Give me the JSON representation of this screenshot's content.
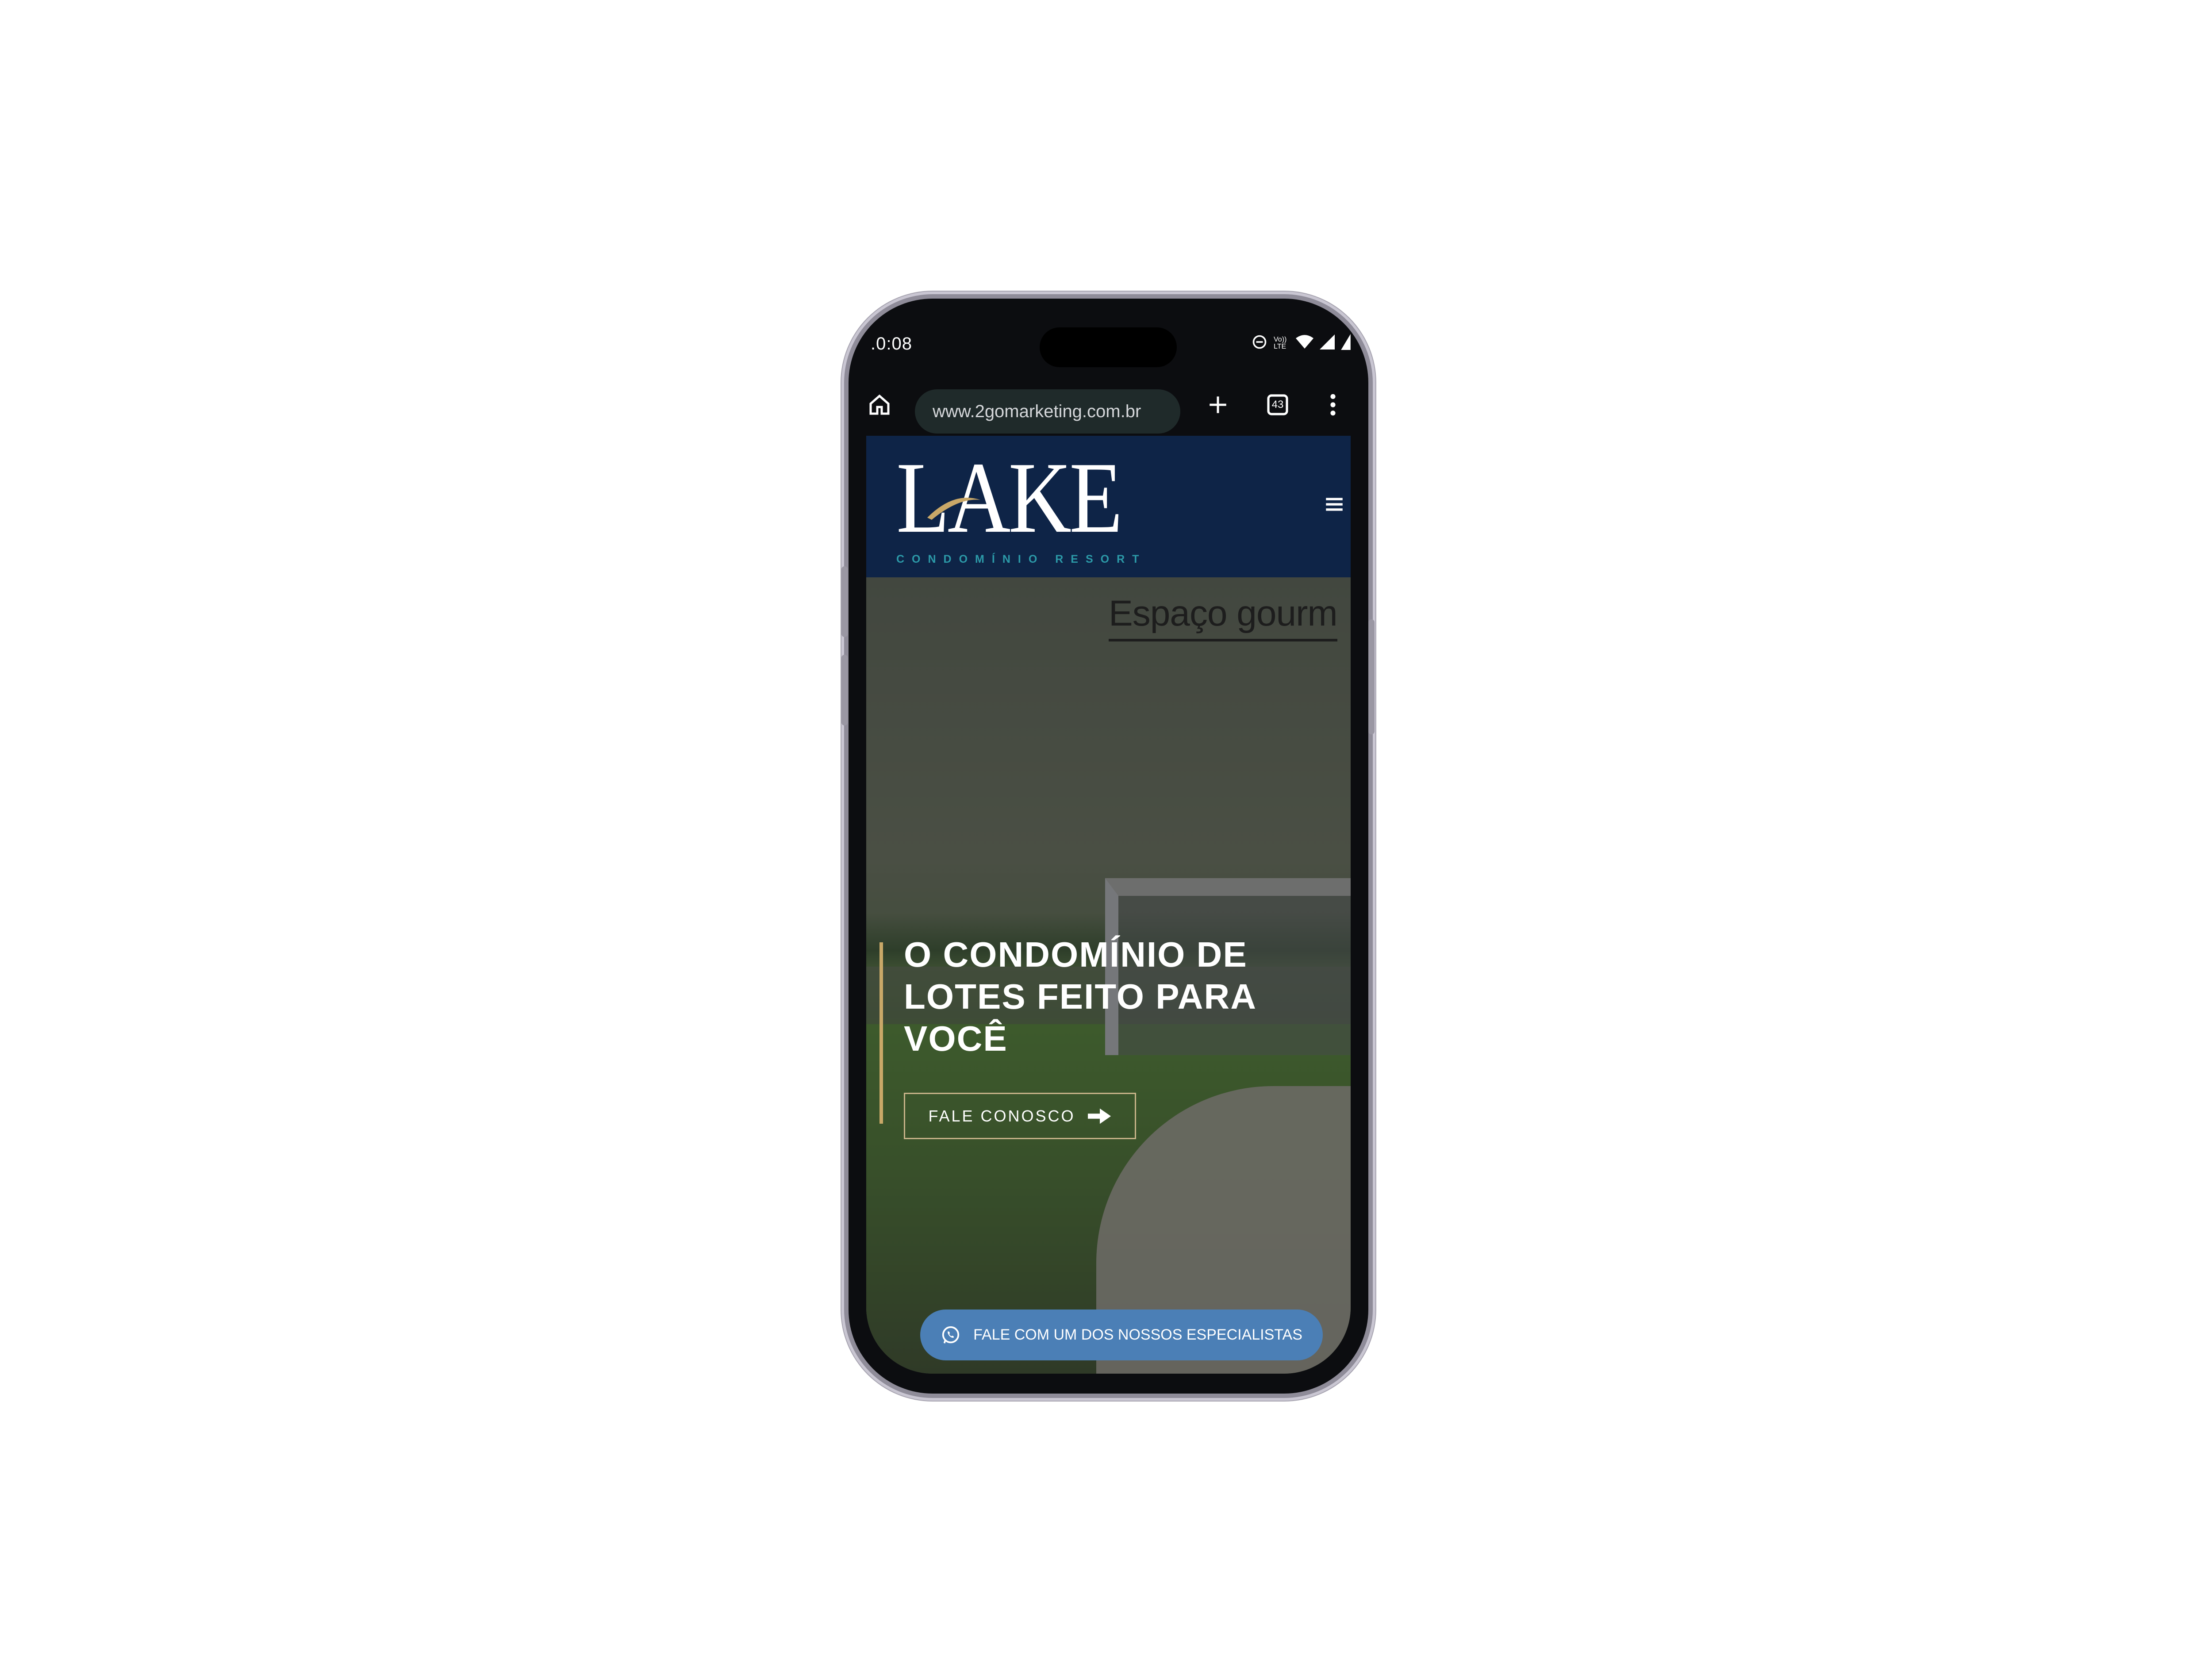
{
  "status_bar": {
    "time": ".0:08",
    "volte_label": "Vo)) LTE"
  },
  "browser": {
    "url": "www.2gomarketing.com.br",
    "tab_count": "43"
  },
  "site": {
    "logo_text": "LAKE",
    "logo_subtitle": "CONDOMÍNIO RESORT",
    "hero_label": "Espaço gourm",
    "headline": "O CONDOMÍNIO DE LOTES FEITO PARA VOCÊ",
    "cta_label": "FALE CONOSCO",
    "whatsapp_label": "FALE COM UM DOS NOSSOS ESPECIALISTAS"
  },
  "colors": {
    "header_bg": "#0e2447",
    "accent_gold": "#c9a868",
    "logo_teal": "#2c9aa8",
    "whatsapp_btn": "#4b7fb6"
  },
  "icons": [
    "dnd-icon",
    "wifi-icon",
    "signal-icon",
    "battery-icon",
    "home-icon",
    "new-tab-icon",
    "tab-switcher-icon",
    "more-vert-icon",
    "hamburger-menu-icon",
    "arrow-right-icon",
    "whatsapp-icon"
  ]
}
